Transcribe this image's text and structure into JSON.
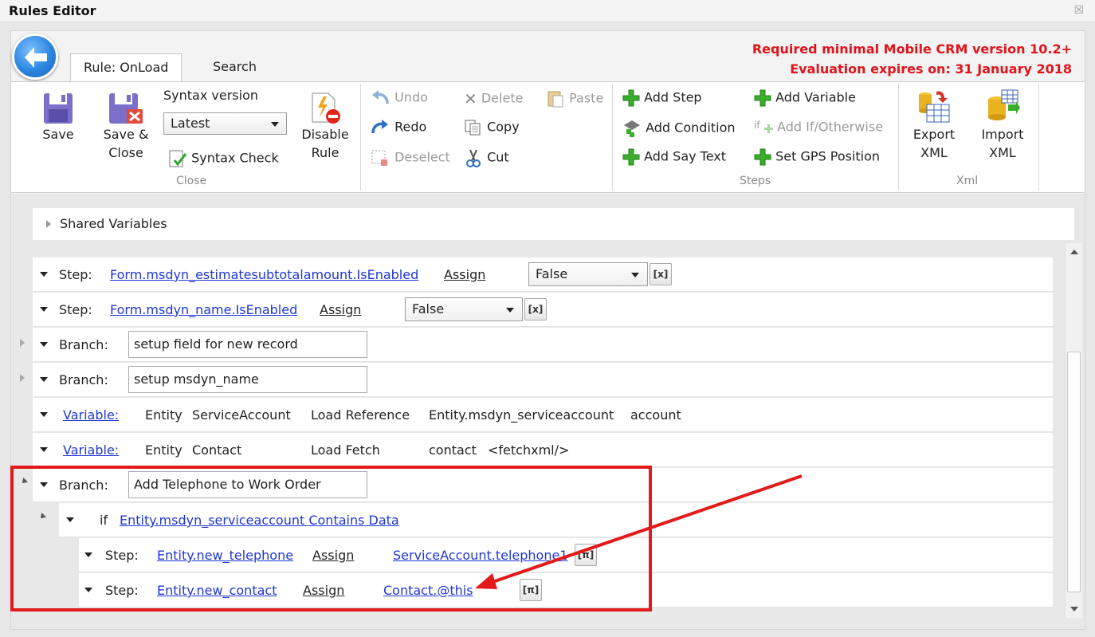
{
  "window": {
    "title": "Rules Editor",
    "close_glyph": "☒"
  },
  "tabs": [
    {
      "label": "Rule: OnLoad",
      "active": true
    },
    {
      "label": "Search",
      "active": false
    }
  ],
  "notice": {
    "line1": "Required minimal Mobile CRM version 10.2+",
    "line2": "Evaluation expires on: 31 January 2018",
    "color": "#e0141c"
  },
  "ribbon": {
    "close_group": {
      "label": "Close",
      "save": "Save",
      "save_close_1": "Save &",
      "save_close_2": "Close",
      "syntax_version_label": "Syntax version",
      "syntax_version_value": "Latest",
      "syntax_check": "Syntax Check",
      "disable_1": "Disable",
      "disable_2": "Rule"
    },
    "edit_group": {
      "undo": "Undo",
      "redo": "Redo",
      "deselect": "Deselect",
      "delete": "Delete",
      "copy": "Copy",
      "cut": "Cut",
      "paste": "Paste"
    },
    "steps_group": {
      "label": "Steps",
      "add_step": "Add Step",
      "add_condition": "Add Condition",
      "add_say_text": "Add Say Text",
      "add_variable": "Add Variable",
      "add_if_otherwise": "Add If/Otherwise",
      "set_gps_position": "Set GPS Position"
    },
    "xml_group": {
      "label": "Xml",
      "export_1": "Export",
      "export_2": "XML",
      "import_1": "Import",
      "import_2": "XML"
    }
  },
  "shared_variables": "Shared Variables",
  "rows": {
    "r1": {
      "kind": "Step:",
      "target": "Form.msdyn_estimatesubtotalamount.IsEnabled",
      "op": "Assign",
      "value": "False"
    },
    "r2": {
      "kind": "Step:",
      "target": "Form.msdyn_name.IsEnabled",
      "op": "Assign",
      "value": "False"
    },
    "r3": {
      "kind": "Branch:",
      "name": "setup field for new record"
    },
    "r4": {
      "kind": "Branch:",
      "name": "setup msdyn_name"
    },
    "r5": {
      "kind": "Variable:",
      "type": "Entity",
      "name": "ServiceAccount",
      "op": "Load Reference",
      "source": "Entity.msdyn_serviceaccount",
      "extra": "account"
    },
    "r6": {
      "kind": "Variable:",
      "type": "Entity",
      "name": "Contact",
      "op": "Load Fetch",
      "source": "contact",
      "extra": "<fetchxml/>"
    },
    "r7": {
      "kind": "Branch:",
      "name": "Add Telephone to Work Order"
    },
    "r8": {
      "kind": "if",
      "condition": "Entity.msdyn_serviceaccount Contains Data"
    },
    "r9": {
      "kind": "Step:",
      "target": "Entity.new_telephone",
      "op": "Assign",
      "value": "ServiceAccount.telephone1"
    },
    "r10": {
      "kind": "Step:",
      "target": "Entity.new_contact",
      "op": "Assign",
      "value": "Contact.@this"
    }
  },
  "xbtn_x": "[x]",
  "xbtn_pi": "[π]",
  "annotation_color": "#e21a1a"
}
